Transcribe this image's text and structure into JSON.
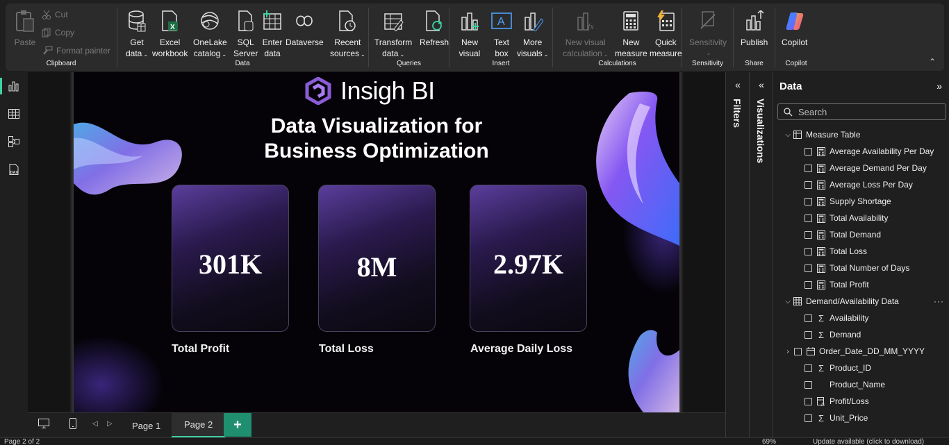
{
  "ribbon": {
    "clipboard": {
      "label": "Clipboard",
      "paste": "Paste",
      "cut": "Cut",
      "copy": "Copy",
      "format_painter": "Format painter"
    },
    "data": {
      "label": "Data",
      "buttons": [
        {
          "line1": "Get",
          "line2": "data",
          "chevron": true,
          "icon": "database-icon"
        },
        {
          "line1": "Excel",
          "line2": "workbook",
          "chevron": false,
          "icon": "excel-icon"
        },
        {
          "line1": "OneLake",
          "line2": "catalog",
          "chevron": true,
          "icon": "onelake-icon"
        },
        {
          "line1": "SQL",
          "line2": "Server",
          "chevron": false,
          "icon": "sql-server-icon"
        },
        {
          "line1": "Enter",
          "line2": "data",
          "chevron": false,
          "icon": "table-add-icon"
        },
        {
          "line1": "Dataverse",
          "line2": "",
          "chevron": false,
          "icon": "dataverse-icon"
        },
        {
          "line1": "Recent",
          "line2": "sources",
          "chevron": true,
          "icon": "recent-sources-icon"
        }
      ]
    },
    "queries": {
      "label": "Queries",
      "transform": {
        "line1": "Transform",
        "line2": "data"
      },
      "refresh": {
        "line1": "Refresh",
        "line2": ""
      }
    },
    "insert": {
      "label": "Insert",
      "new_visual": {
        "line1": "New",
        "line2": "visual"
      },
      "text_box": {
        "line1": "Text",
        "line2": "box"
      },
      "more_visuals": {
        "line1": "More",
        "line2": "visuals"
      }
    },
    "calculations": {
      "label": "Calculations",
      "new_visual_calc": {
        "line1": "New visual",
        "line2": "calculation"
      },
      "new_measure": {
        "line1": "New",
        "line2": "measure"
      },
      "quick_measure": {
        "line1": "Quick",
        "line2": "measure"
      }
    },
    "sensitivity": {
      "label": "Sensitivity",
      "button": "Sensitivity"
    },
    "share": {
      "label": "Share",
      "publish": "Publish"
    },
    "copilot": {
      "label": "Copilot",
      "button": "Copilot"
    }
  },
  "report": {
    "brand": "Insigh BI",
    "title_line1": "Data Visualization for",
    "title_line2": "Business Optimization",
    "kpis": [
      {
        "value": "301K",
        "label": "Total Profit"
      },
      {
        "value": "8M",
        "label": "Total Loss"
      },
      {
        "value": "2.97K",
        "label": "Average Daily Loss"
      }
    ]
  },
  "pages": {
    "tabs": [
      "Page 1",
      "Page 2"
    ],
    "active": "Page 2",
    "add": "+"
  },
  "panes": {
    "filters": "Filters",
    "visualizations": "Visualizations"
  },
  "data_pane": {
    "title": "Data",
    "search_placeholder": "Search",
    "tables": [
      {
        "name": "Measure Table",
        "fields": [
          "Average Availability Per Day",
          "Average Demand Per Day",
          "Average Loss Per Day",
          "Supply Shortage",
          "Total Availability",
          "Total Demand",
          "Total Loss",
          "Total Number of Days",
          "Total Profit"
        ]
      },
      {
        "name": "Demand/Availability Data",
        "fields": [
          {
            "name": "Availability",
            "icon": "sigma-icon"
          },
          {
            "name": "Demand",
            "icon": "sigma-icon"
          },
          {
            "name": "Order_Date_DD_MM_YYYY",
            "icon": "calendar-icon"
          },
          {
            "name": "Product_ID",
            "icon": "sigma-icon"
          },
          {
            "name": "Product_Name",
            "icon": "none"
          },
          {
            "name": "Profit/Loss",
            "icon": "calculated-column-icon"
          },
          {
            "name": "Unit_Price",
            "icon": "sigma-icon"
          }
        ]
      }
    ]
  },
  "status": {
    "page": "Page 2 of 2",
    "zoom": "69%",
    "update_text": "Update available (click to download)"
  },
  "colors": {
    "accent": "#3ed1a5",
    "kpi_purple": "#5b3e9c",
    "brand_purple": "#8a5cd6"
  }
}
